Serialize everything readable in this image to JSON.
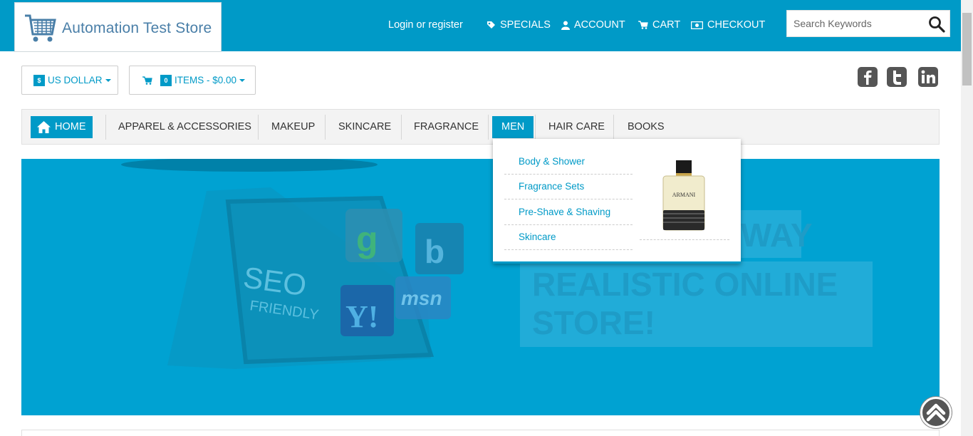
{
  "header": {
    "logo_text": "Automation Test Store",
    "login": "Login or register",
    "links": [
      "SPECIALS",
      "ACCOUNT",
      "CART",
      "CHECKOUT"
    ],
    "search_placeholder": "Search Keywords"
  },
  "toolbar": {
    "currency_badge": "$",
    "currency_label": "US DOLLAR",
    "cart_count": "0",
    "cart_label": "ITEMS - $0.00"
  },
  "social": [
    "facebook-icon",
    "twitter-icon",
    "linkedin-icon"
  ],
  "nav": {
    "items": [
      "HOME",
      "APPAREL & ACCESSORIES",
      "MAKEUP",
      "SKINCARE",
      "FRAGRANCE",
      "MEN",
      "HAIR CARE",
      "BOOKS"
    ],
    "active": "MEN"
  },
  "men_menu": {
    "items": [
      "Body & Shower",
      "Fragrance Sets",
      "Pre-Shave & Shaving",
      "Skincare"
    ],
    "image_label": "ARMANI"
  },
  "banner": {
    "screen_text_1": "SEO",
    "screen_text_2": "FRIENDLY",
    "headline_1": "WAY",
    "headline_2": "REALISTIC ONLINE",
    "headline_3": "STORE!",
    "logos": [
      "g",
      "b",
      "Y!",
      "msn"
    ]
  },
  "colors": {
    "brand": "#009ac7",
    "banner": "#00a2d2"
  }
}
